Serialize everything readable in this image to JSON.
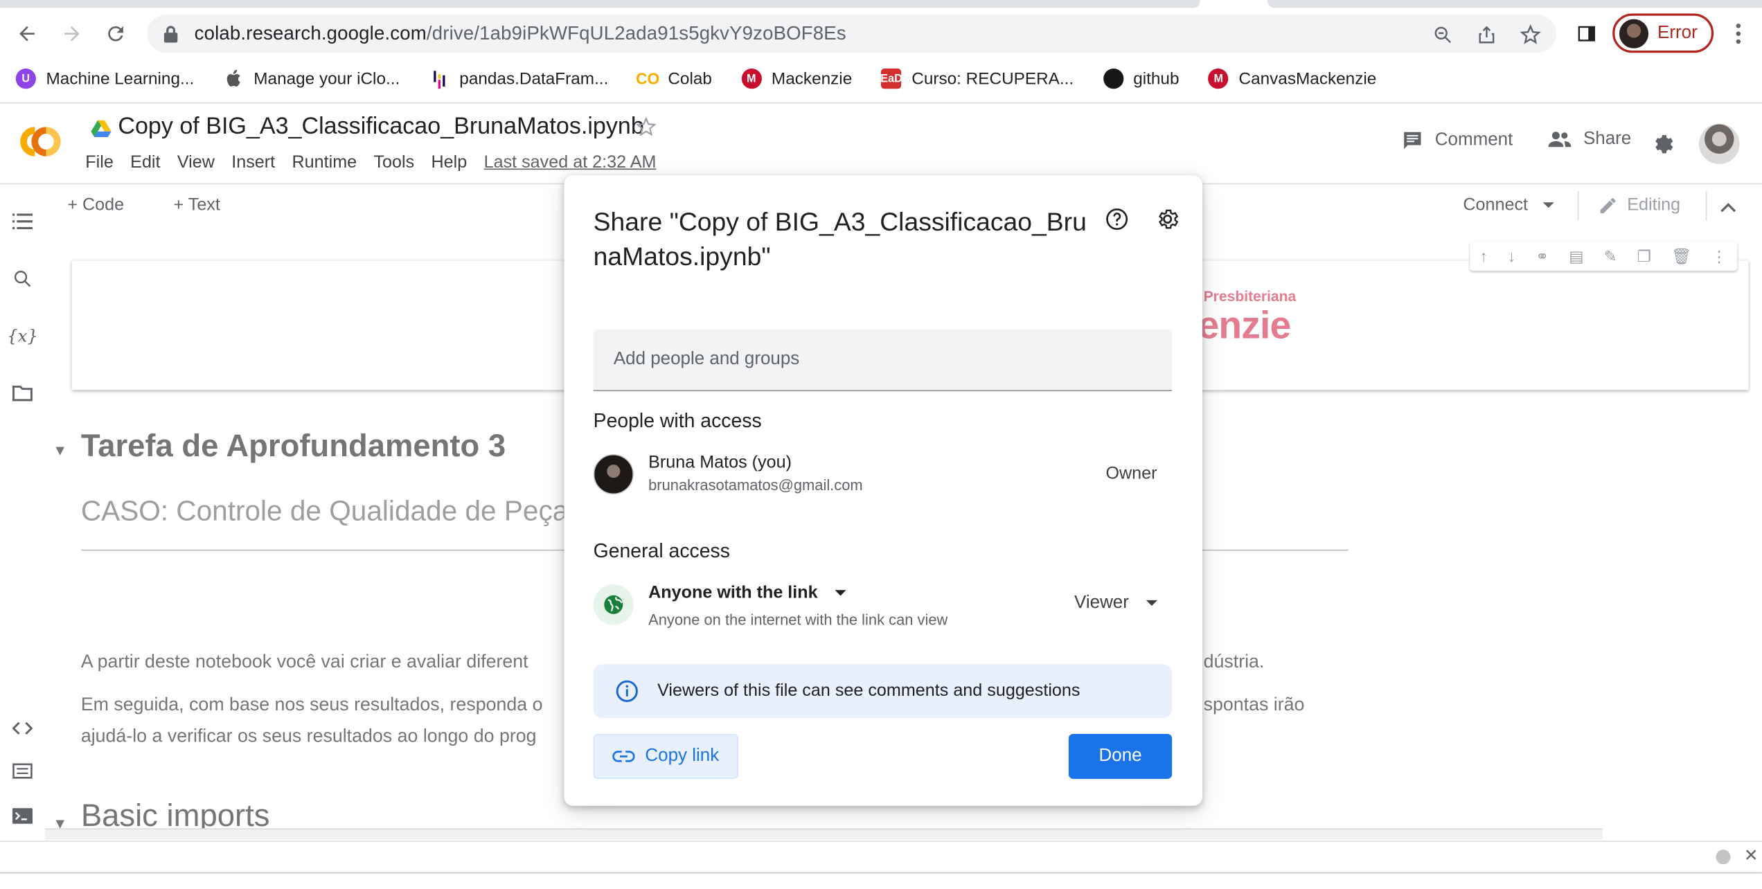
{
  "browser": {
    "url_host": "colab.research.google.com",
    "url_path": "/drive/1ab9iPkWFqUL2ada91s5gkvY9zoBOF8Es",
    "profile_status": "Error",
    "bookmarks": [
      {
        "label": "Machine Learning...",
        "icon": "purple-u-icon",
        "color": "#8e44e6"
      },
      {
        "label": "Manage your iClo...",
        "icon": "apple-icon",
        "color": "#555555"
      },
      {
        "label": "pandas.DataFram...",
        "icon": "pandas-icon",
        "color": "#150458"
      },
      {
        "label": "Colab",
        "icon": "colab-icon",
        "color": "#f9ab00"
      },
      {
        "label": "Mackenzie",
        "icon": "mackenzie-icon",
        "color": "#c8102e"
      },
      {
        "label": "Curso: RECUPERA...",
        "icon": "ead-icon",
        "color": "#d32f2f"
      },
      {
        "label": "github",
        "icon": "github-icon",
        "color": "#181717"
      },
      {
        "label": "CanvasMackenzie",
        "icon": "canvas-mackenzie-icon",
        "color": "#c8102e"
      }
    ]
  },
  "colab": {
    "doc_title": "Copy of BIG_A3_Classificacao_BrunaMatos.ipynb",
    "menu": [
      "File",
      "Edit",
      "View",
      "Insert",
      "Runtime",
      "Tools",
      "Help"
    ],
    "last_saved": "Last saved at 2:32 AM",
    "comment_label": "Comment",
    "share_label": "Share",
    "toolbar_code": "Code",
    "toolbar_text": "Text",
    "connect_label": "Connect",
    "editing_label": "Editing"
  },
  "notebook": {
    "logo_line1": "Presbiteriana",
    "logo_line2": "enzie",
    "heading": "Tarefa de Aprofundamento 3",
    "subheading": "CASO: Controle de Qualidade de Peças",
    "para1_left": "A partir deste notebook você vai criar e avaliar diferent",
    "para1_right": "dústria.",
    "para2_left": "Em seguida, com base nos seus resultados, responda o",
    "para2_right": "spontas irão",
    "para3_left": "ajudá-lo a verificar os seus resultados ao longo do prog",
    "heading2": "Basic imports"
  },
  "share_dialog": {
    "title": "Share \"Copy of BIG_A3_Classificacao_BrunaMatos.ipynb\"",
    "add_placeholder": "Add people and groups",
    "people_heading": "People with access",
    "person_name": "Bruna Matos (you)",
    "person_email": "brunakrasotamatos@gmail.com",
    "person_role": "Owner",
    "general_heading": "General access",
    "access_type": "Anyone with the link",
    "access_desc": "Anyone on the internet with the link can view",
    "access_role": "Viewer",
    "info_text": "Viewers of this file can see comments and suggestions",
    "copy_link_label": "Copy link",
    "done_label": "Done"
  },
  "colors": {
    "accent": "#1a73e8",
    "error": "#b3261e",
    "colab_orange": "#f9ab00"
  }
}
